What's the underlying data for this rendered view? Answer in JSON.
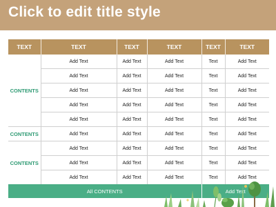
{
  "slide": {
    "title": "Click to edit title style"
  },
  "table": {
    "headers": [
      "TEXT",
      "TEXT",
      "TEXT",
      "TEXT",
      "TEXT",
      "TEXT"
    ],
    "groups": [
      "CONTENTS",
      "CONTENTS",
      "CONTENTS"
    ],
    "rows": [
      [
        "Add Text",
        "Add Text",
        "Add Text",
        "Text",
        "Add Text"
      ],
      [
        "Add Text",
        "Add Text",
        "Add Text",
        "Text",
        "Add Text"
      ],
      [
        "Add Text",
        "Add Text",
        "Add Text",
        "Text",
        "Add Text"
      ],
      [
        "Add Text",
        "Add Text",
        "Add Text",
        "Text",
        "Add Text"
      ],
      [
        "Add Text",
        "Add Text",
        "Add Text",
        "Text",
        "Add Text"
      ],
      [
        "Add Text",
        "Add Text",
        "Add Text",
        "Text",
        "Add Text"
      ],
      [
        "Add Text",
        "Add Text",
        "Add Text",
        "Text",
        "Add Text"
      ],
      [
        "Add Text",
        "Add Text",
        "Add Text",
        "Text",
        "Add Text"
      ],
      [
        "Add Text",
        "Add Text",
        "Add Text",
        "Text",
        "Add Text"
      ]
    ],
    "footer": {
      "left": "All CONTENTS",
      "right": "Add Text"
    }
  },
  "colors": {
    "header_bg": "#c4a27a",
    "table_header_bg": "#b8935f",
    "accent_green": "#4aae86",
    "contents_text": "#2e9a73"
  },
  "icons": {
    "decoration": "plants-illustration"
  }
}
